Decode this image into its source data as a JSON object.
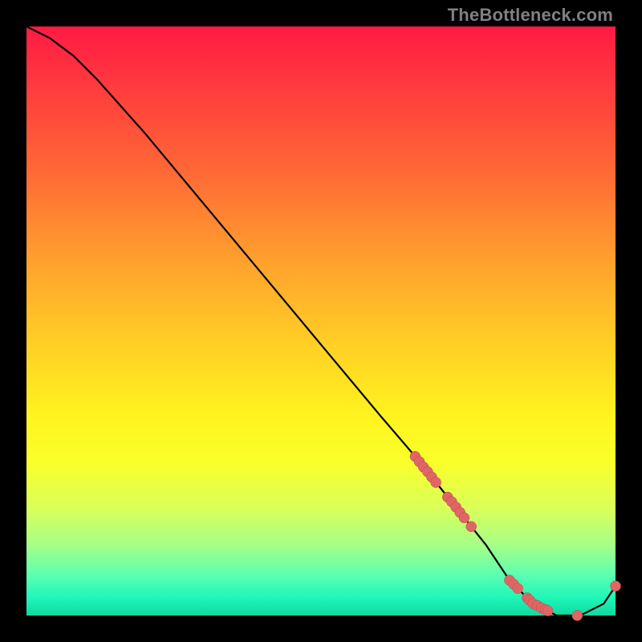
{
  "watermark": "TheBottleneck.com",
  "colors": {
    "background": "#000000",
    "curve": "#000000",
    "marker_fill": "#e06666",
    "marker_stroke": "#b94a4a"
  },
  "chart_data": {
    "type": "line",
    "title": "",
    "xlabel": "",
    "ylabel": "",
    "xlim": [
      0,
      100
    ],
    "ylim": [
      0,
      100
    ],
    "grid": false,
    "series": [
      {
        "name": "curve",
        "x": [
          0,
          4,
          8,
          12,
          20,
          30,
          40,
          50,
          60,
          66,
          70,
          74,
          78,
          82,
          86,
          90,
          94,
          98,
          100
        ],
        "y": [
          100,
          98,
          95,
          91,
          82,
          70,
          58,
          46,
          34,
          27,
          22,
          17,
          12,
          6,
          2,
          0,
          0,
          2,
          5
        ]
      }
    ],
    "markers": [
      {
        "x": 66.0,
        "y": 27.0
      },
      {
        "x": 66.7,
        "y": 26.1
      },
      {
        "x": 67.4,
        "y": 25.2
      },
      {
        "x": 68.1,
        "y": 24.4
      },
      {
        "x": 68.8,
        "y": 23.5
      },
      {
        "x": 69.5,
        "y": 22.6
      },
      {
        "x": 71.5,
        "y": 20.1
      },
      {
        "x": 72.2,
        "y": 19.3
      },
      {
        "x": 72.9,
        "y": 18.4
      },
      {
        "x": 73.6,
        "y": 17.5
      },
      {
        "x": 74.3,
        "y": 16.6
      },
      {
        "x": 75.5,
        "y": 15.1
      },
      {
        "x": 82.0,
        "y": 6.0
      },
      {
        "x": 82.7,
        "y": 5.3
      },
      {
        "x": 83.4,
        "y": 4.6
      },
      {
        "x": 85.0,
        "y": 3.0
      },
      {
        "x": 85.4,
        "y": 2.6
      },
      {
        "x": 86.0,
        "y": 2.0
      },
      {
        "x": 86.7,
        "y": 1.7
      },
      {
        "x": 87.4,
        "y": 1.3
      },
      {
        "x": 88.1,
        "y": 1.0
      },
      {
        "x": 88.5,
        "y": 0.8
      },
      {
        "x": 93.5,
        "y": 0.0
      },
      {
        "x": 100.0,
        "y": 5.0
      }
    ]
  }
}
